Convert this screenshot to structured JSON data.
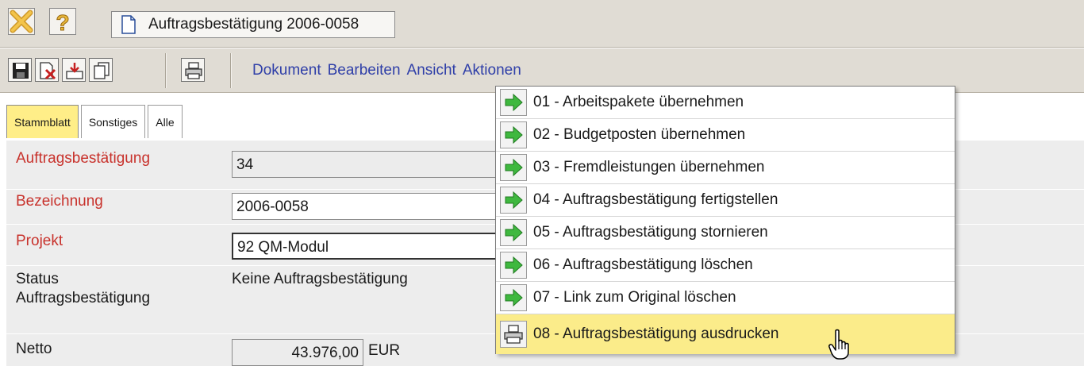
{
  "window": {
    "title": "Auftragsbestätigung 2006-0058",
    "close_icon": "close-x-icon",
    "help_icon": "help-question-icon"
  },
  "toolbar": {
    "tools": [
      "save-icon",
      "delete-icon",
      "import-icon",
      "copy-icon",
      "print-icon"
    ],
    "menu": [
      "Dokument",
      "Bearbeiten",
      "Ansicht",
      "Aktionen"
    ]
  },
  "tabs": [
    {
      "label": "Stammblatt",
      "active": true
    },
    {
      "label": "Sonstiges",
      "active": false
    },
    {
      "label": "Alle",
      "active": false
    }
  ],
  "form": {
    "auftrag_label": "Auftragsbestätigung",
    "auftrag_value": "34",
    "bezeichnung_label": "Bezeichnung",
    "bezeichnung_value": "2006-0058",
    "projekt_label": "Projekt",
    "projekt_value": "92 QM-Modul",
    "status_label_1": "Status",
    "status_label_2": "Auftragsbestätigung",
    "status_value": "Keine Auftragsbestätigung",
    "netto_label": "Netto",
    "netto_value": "43.976,00",
    "netto_currency": "EUR"
  },
  "actions_menu": {
    "items": [
      "01 - Arbeitspakete übernehmen",
      "02 - Budgetposten übernehmen",
      "03 - Fremdleistungen übernehmen",
      "04 - Auftragsbestätigung fertigstellen",
      "05 - Auftragsbestätigung stornieren",
      "06 - Auftragsbestätigung löschen",
      "07 - Link zum Original löschen",
      "08 - Auftragsbestätigung ausdrucken"
    ],
    "highlighted_index": 7
  },
  "colors": {
    "required_label": "#c8322c",
    "menu_link": "#2f3fa8",
    "active_tab": "#ffee88",
    "highlight": "#fbec8a",
    "arrow_green": "#3fb83f"
  }
}
